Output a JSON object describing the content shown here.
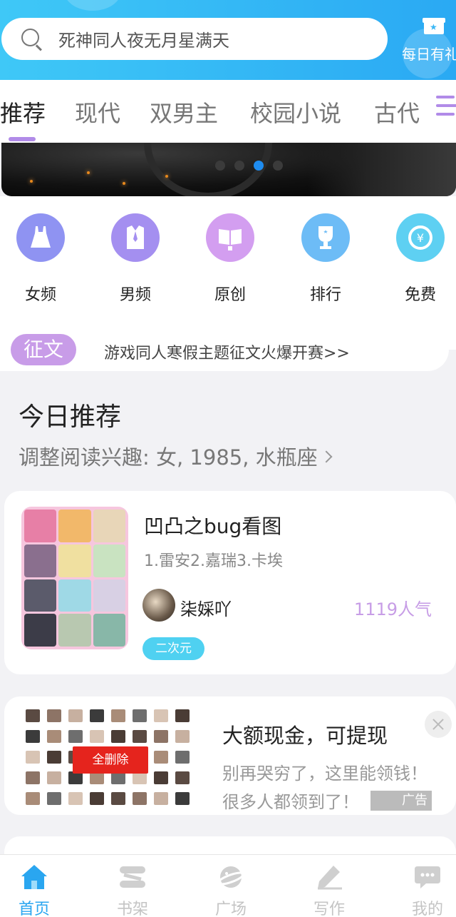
{
  "search": {
    "placeholder": "死神同人夜无月星满天"
  },
  "daily_gift": {
    "label": "每日有礼"
  },
  "tabs": [
    {
      "label": "推荐",
      "active": true
    },
    {
      "label": "现代"
    },
    {
      "label": "双男主"
    },
    {
      "label": "校园小说"
    },
    {
      "label": "古代"
    }
  ],
  "banner": {
    "slide_count": 4,
    "active_index": 2
  },
  "categories": [
    {
      "label": "女频",
      "icon": "dress-icon",
      "color": "#8f93f2"
    },
    {
      "label": "男频",
      "icon": "shirt-icon",
      "color": "#a48ff0"
    },
    {
      "label": "原创",
      "icon": "open-book-icon",
      "color": "#d39ef0"
    },
    {
      "label": "排行",
      "icon": "trophy-icon",
      "color": "#6dbcf6"
    },
    {
      "label": "免费",
      "icon": "yuan-coin-icon",
      "color": "#5ed0f2"
    }
  ],
  "notice": {
    "tag": "征文",
    "text": "游戏同人寒假主题征文火爆开赛>>"
  },
  "today": {
    "title": "今日推荐",
    "subtitle": "调整阅读兴趣: 女, 1985, 水瓶座"
  },
  "book": {
    "title": "凹凸之bug看图",
    "description": "1.雷安2.嘉瑞3.卡埃",
    "author": "柒婇吖",
    "popularity": "1119人气",
    "tag": "二次元"
  },
  "ad": {
    "image_button": "全删除",
    "title": "大额现金，可提现",
    "description": "别再哭穷了，这里能领钱！很多人都领到了！",
    "label": "广告"
  },
  "nav": [
    {
      "label": "首页",
      "icon": "home-icon",
      "active": true
    },
    {
      "label": "书架",
      "icon": "bookshelf-icon"
    },
    {
      "label": "广场",
      "icon": "planet-icon"
    },
    {
      "label": "写作",
      "icon": "pencil-icon"
    },
    {
      "label": "我的",
      "icon": "chat-bubble-icon"
    }
  ],
  "colors": {
    "header": "#2aa9f3",
    "accent_purple": "#b18be8",
    "popularity": "#c79de6",
    "tag": "#4fd1f1",
    "nav_active": "#2aa6f0"
  }
}
